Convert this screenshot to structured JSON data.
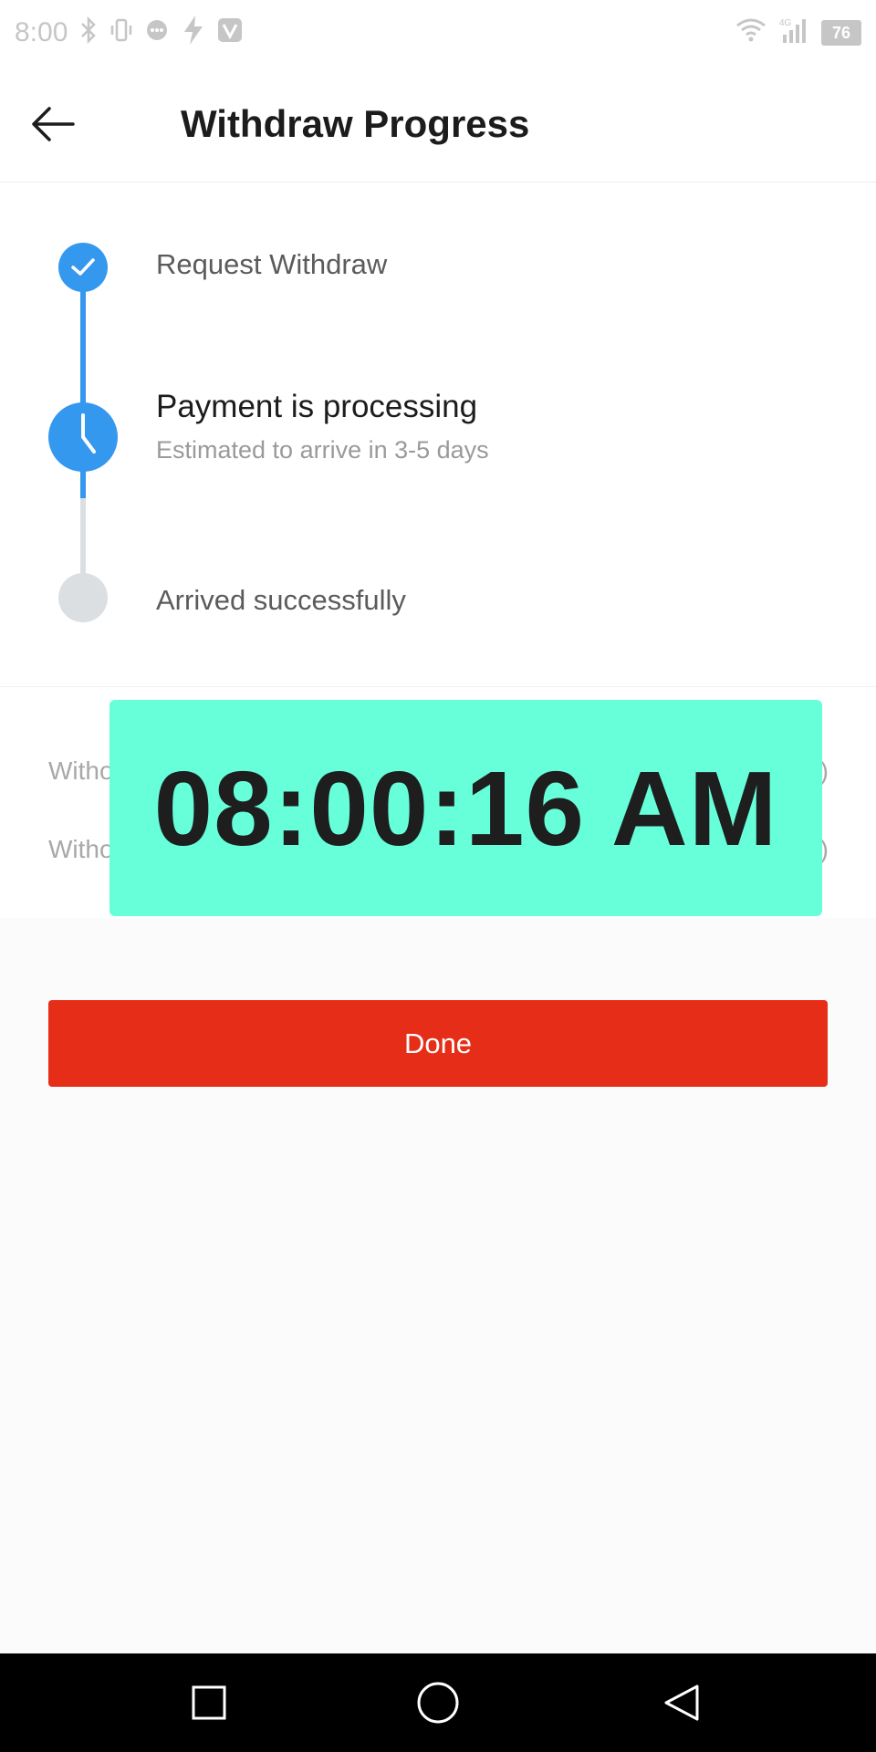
{
  "status_bar": {
    "time": "8:00",
    "battery": "76",
    "network": "4G"
  },
  "header": {
    "title": "Withdraw Progress",
    "back_icon": "arrow-left-icon"
  },
  "progress": {
    "steps": [
      {
        "label": "Request Withdraw",
        "state": "done",
        "icon": "check-icon"
      },
      {
        "label": "Payment is processing",
        "subtitle": "Estimated to arrive in 3-5 days",
        "state": "current",
        "icon": "clock-icon"
      },
      {
        "label": "Arrived successfully",
        "state": "pending"
      }
    ],
    "colors": {
      "active": "#3598ef",
      "inactive": "#dcdfe1"
    }
  },
  "details": {
    "rows": [
      {
        "label": "Witho",
        "value": ")"
      },
      {
        "label": "Witho",
        "value": ")"
      }
    ]
  },
  "overlay": {
    "time": "08:00:16 AM",
    "background": "#66ffd9"
  },
  "actions": {
    "done_label": "Done",
    "done_color": "#e52d18"
  },
  "nav_bar": {
    "recents_icon": "square-icon",
    "home_icon": "circle-icon",
    "back_icon": "triangle-back-icon"
  }
}
